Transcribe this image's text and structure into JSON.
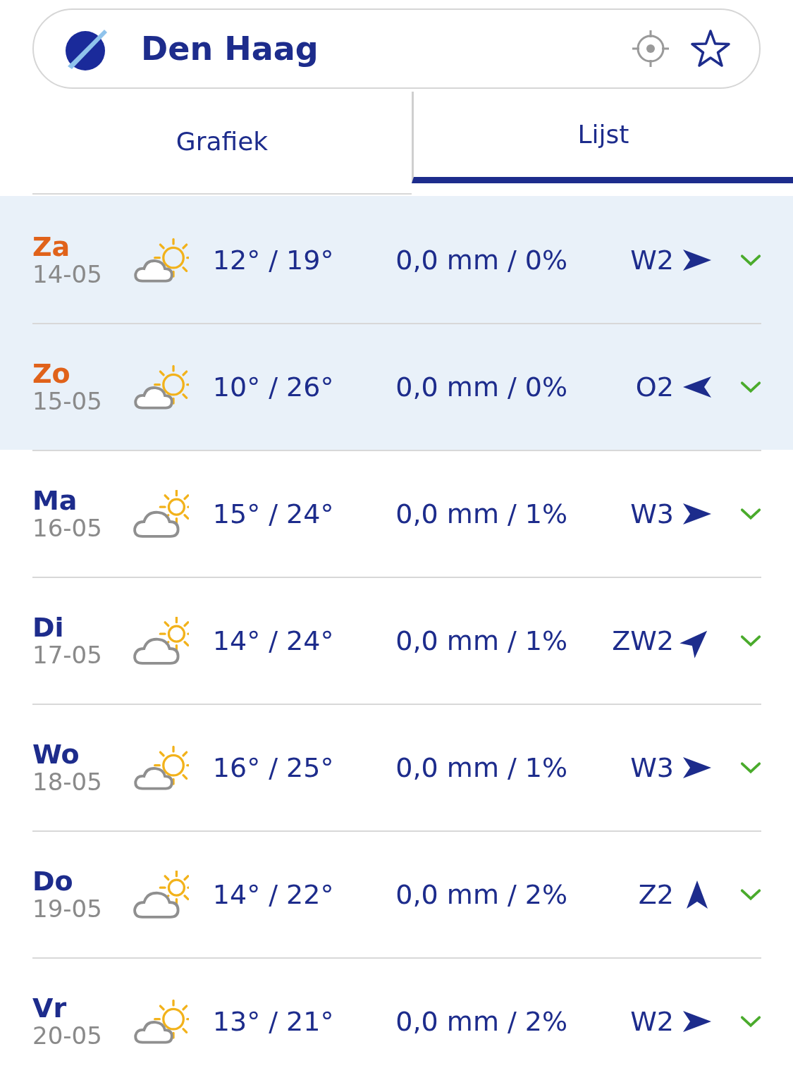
{
  "header": {
    "city": "Den Haag"
  },
  "tabs": [
    {
      "label": "Grafiek",
      "selected": false
    },
    {
      "label": "Lijst",
      "selected": true
    }
  ],
  "days": [
    {
      "day": "Za",
      "date": "14-05",
      "weekend": true,
      "kind": "sunny",
      "temps": "12° / 19°",
      "rain": "0,0 mm / 0%",
      "wind": {
        "label": "W2",
        "kind": "east"
      }
    },
    {
      "day": "Zo",
      "date": "15-05",
      "weekend": true,
      "kind": "sunny",
      "temps": "10° / 26°",
      "rain": "0,0 mm / 0%",
      "wind": {
        "label": "O2",
        "kind": "west"
      }
    },
    {
      "day": "Ma",
      "date": "16-05",
      "weekend": false,
      "kind": "cloudy",
      "temps": "15° / 24°",
      "rain": "0,0 mm / 1%",
      "wind": {
        "label": "W3",
        "kind": "east"
      }
    },
    {
      "day": "Di",
      "date": "17-05",
      "weekend": false,
      "kind": "cloudy",
      "temps": "14° / 24°",
      "rain": "0,0 mm / 1%",
      "wind": {
        "label": "ZW2",
        "kind": "northeast"
      }
    },
    {
      "day": "Wo",
      "date": "18-05",
      "weekend": false,
      "kind": "sunny",
      "temps": "16° / 25°",
      "rain": "0,0 mm / 1%",
      "wind": {
        "label": "W3",
        "kind": "east"
      }
    },
    {
      "day": "Do",
      "date": "19-05",
      "weekend": false,
      "kind": "cloudy",
      "temps": "14° / 22°",
      "rain": "0,0 mm / 2%",
      "wind": {
        "label": "Z2",
        "kind": "north"
      }
    },
    {
      "day": "Vr",
      "date": "20-05",
      "weekend": false,
      "kind": "sunny",
      "temps": "13° / 21°",
      "rain": "0,0 mm / 2%",
      "wind": {
        "label": "W2",
        "kind": "east"
      }
    }
  ]
}
